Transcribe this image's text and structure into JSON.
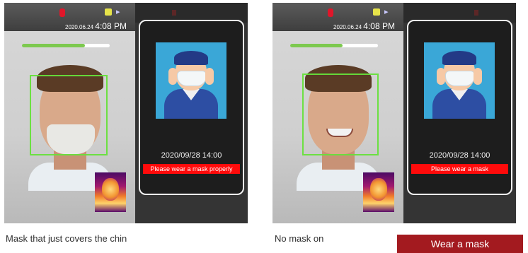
{
  "panels": [
    {
      "status": {
        "date": "2020.06.24",
        "time": "4:08 PM"
      },
      "verification_progress": 0.72,
      "popup": {
        "datetime": "2020/09/28 14:00",
        "alert": "Please wear a mask properly"
      },
      "caption": "Mask that just covers the chin"
    },
    {
      "status": {
        "date": "2020.06.24",
        "time": "4:08 PM"
      },
      "verification_progress": 0.6,
      "popup": {
        "datetime": "2020/09/28 14:00",
        "alert": "Please wear a mask"
      },
      "caption": "No mask on"
    }
  ],
  "badge": "Wear a mask",
  "colors": {
    "alert": "#ff0b0b",
    "badge": "#a31a1f",
    "face_box": "#66e03a",
    "progress": "#7dc94f"
  },
  "icons": [
    "recording-icon",
    "sim-card-icon",
    "network-icon",
    "thermal-camera-preview",
    "mask-illustration"
  ]
}
